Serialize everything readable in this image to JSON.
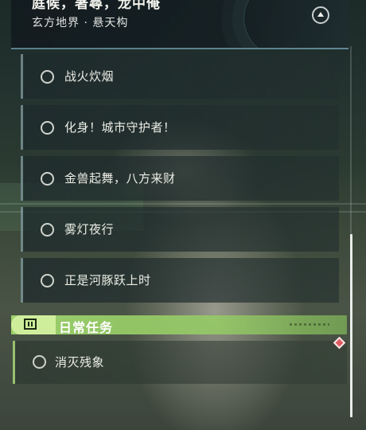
{
  "header": {
    "title": "庭候，著尋，龙中俺",
    "subtitle": "玄方地界 · 悬天构",
    "collapse_icon": "chevron-up-icon"
  },
  "quests": [
    {
      "label": "战火炊烟",
      "status": "incomplete"
    },
    {
      "label": "化身！城市守护者！",
      "status": "incomplete"
    },
    {
      "label": "金兽起舞，八方来财",
      "status": "incomplete"
    },
    {
      "label": "雾灯夜行",
      "status": "incomplete"
    },
    {
      "label": "正是河豚跃上时",
      "status": "incomplete"
    }
  ],
  "daily": {
    "header_label": "日常任务",
    "header_icon": "exclamation-box-icon",
    "accent_color": "#a6d96a",
    "items": [
      {
        "label": "消灭残象",
        "status": "incomplete"
      }
    ]
  },
  "marker": {
    "icon": "diamond-marker-icon",
    "color": "#e05a62"
  },
  "scrollbar": {
    "position_fraction": 0.52,
    "visible_fraction": 0.5
  }
}
